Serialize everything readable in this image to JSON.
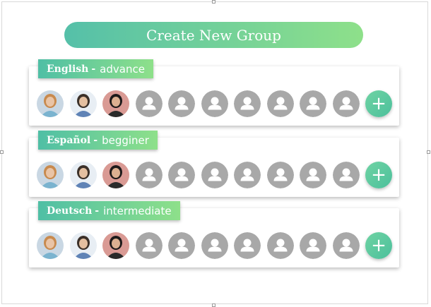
{
  "header": {
    "create_label": "Create New Group"
  },
  "accent": {
    "start": "#55c0a9",
    "end": "#8ee08a",
    "placeholder": "#a8a8a8"
  },
  "groups": [
    {
      "language": "English",
      "separator": "-",
      "level": "advance",
      "members_with_photo": 3,
      "empty_slots": 7,
      "add_icon": "plus-icon"
    },
    {
      "language": "Español",
      "separator": "-",
      "level": "begginer",
      "members_with_photo": 3,
      "empty_slots": 7,
      "add_icon": "plus-icon"
    },
    {
      "language": "Deutsch",
      "separator": "-",
      "level": "intermediate",
      "members_with_photo": 3,
      "empty_slots": 7,
      "add_icon": "plus-icon"
    }
  ],
  "icons": {
    "placeholder": "user-icon",
    "add": "plus-icon"
  }
}
